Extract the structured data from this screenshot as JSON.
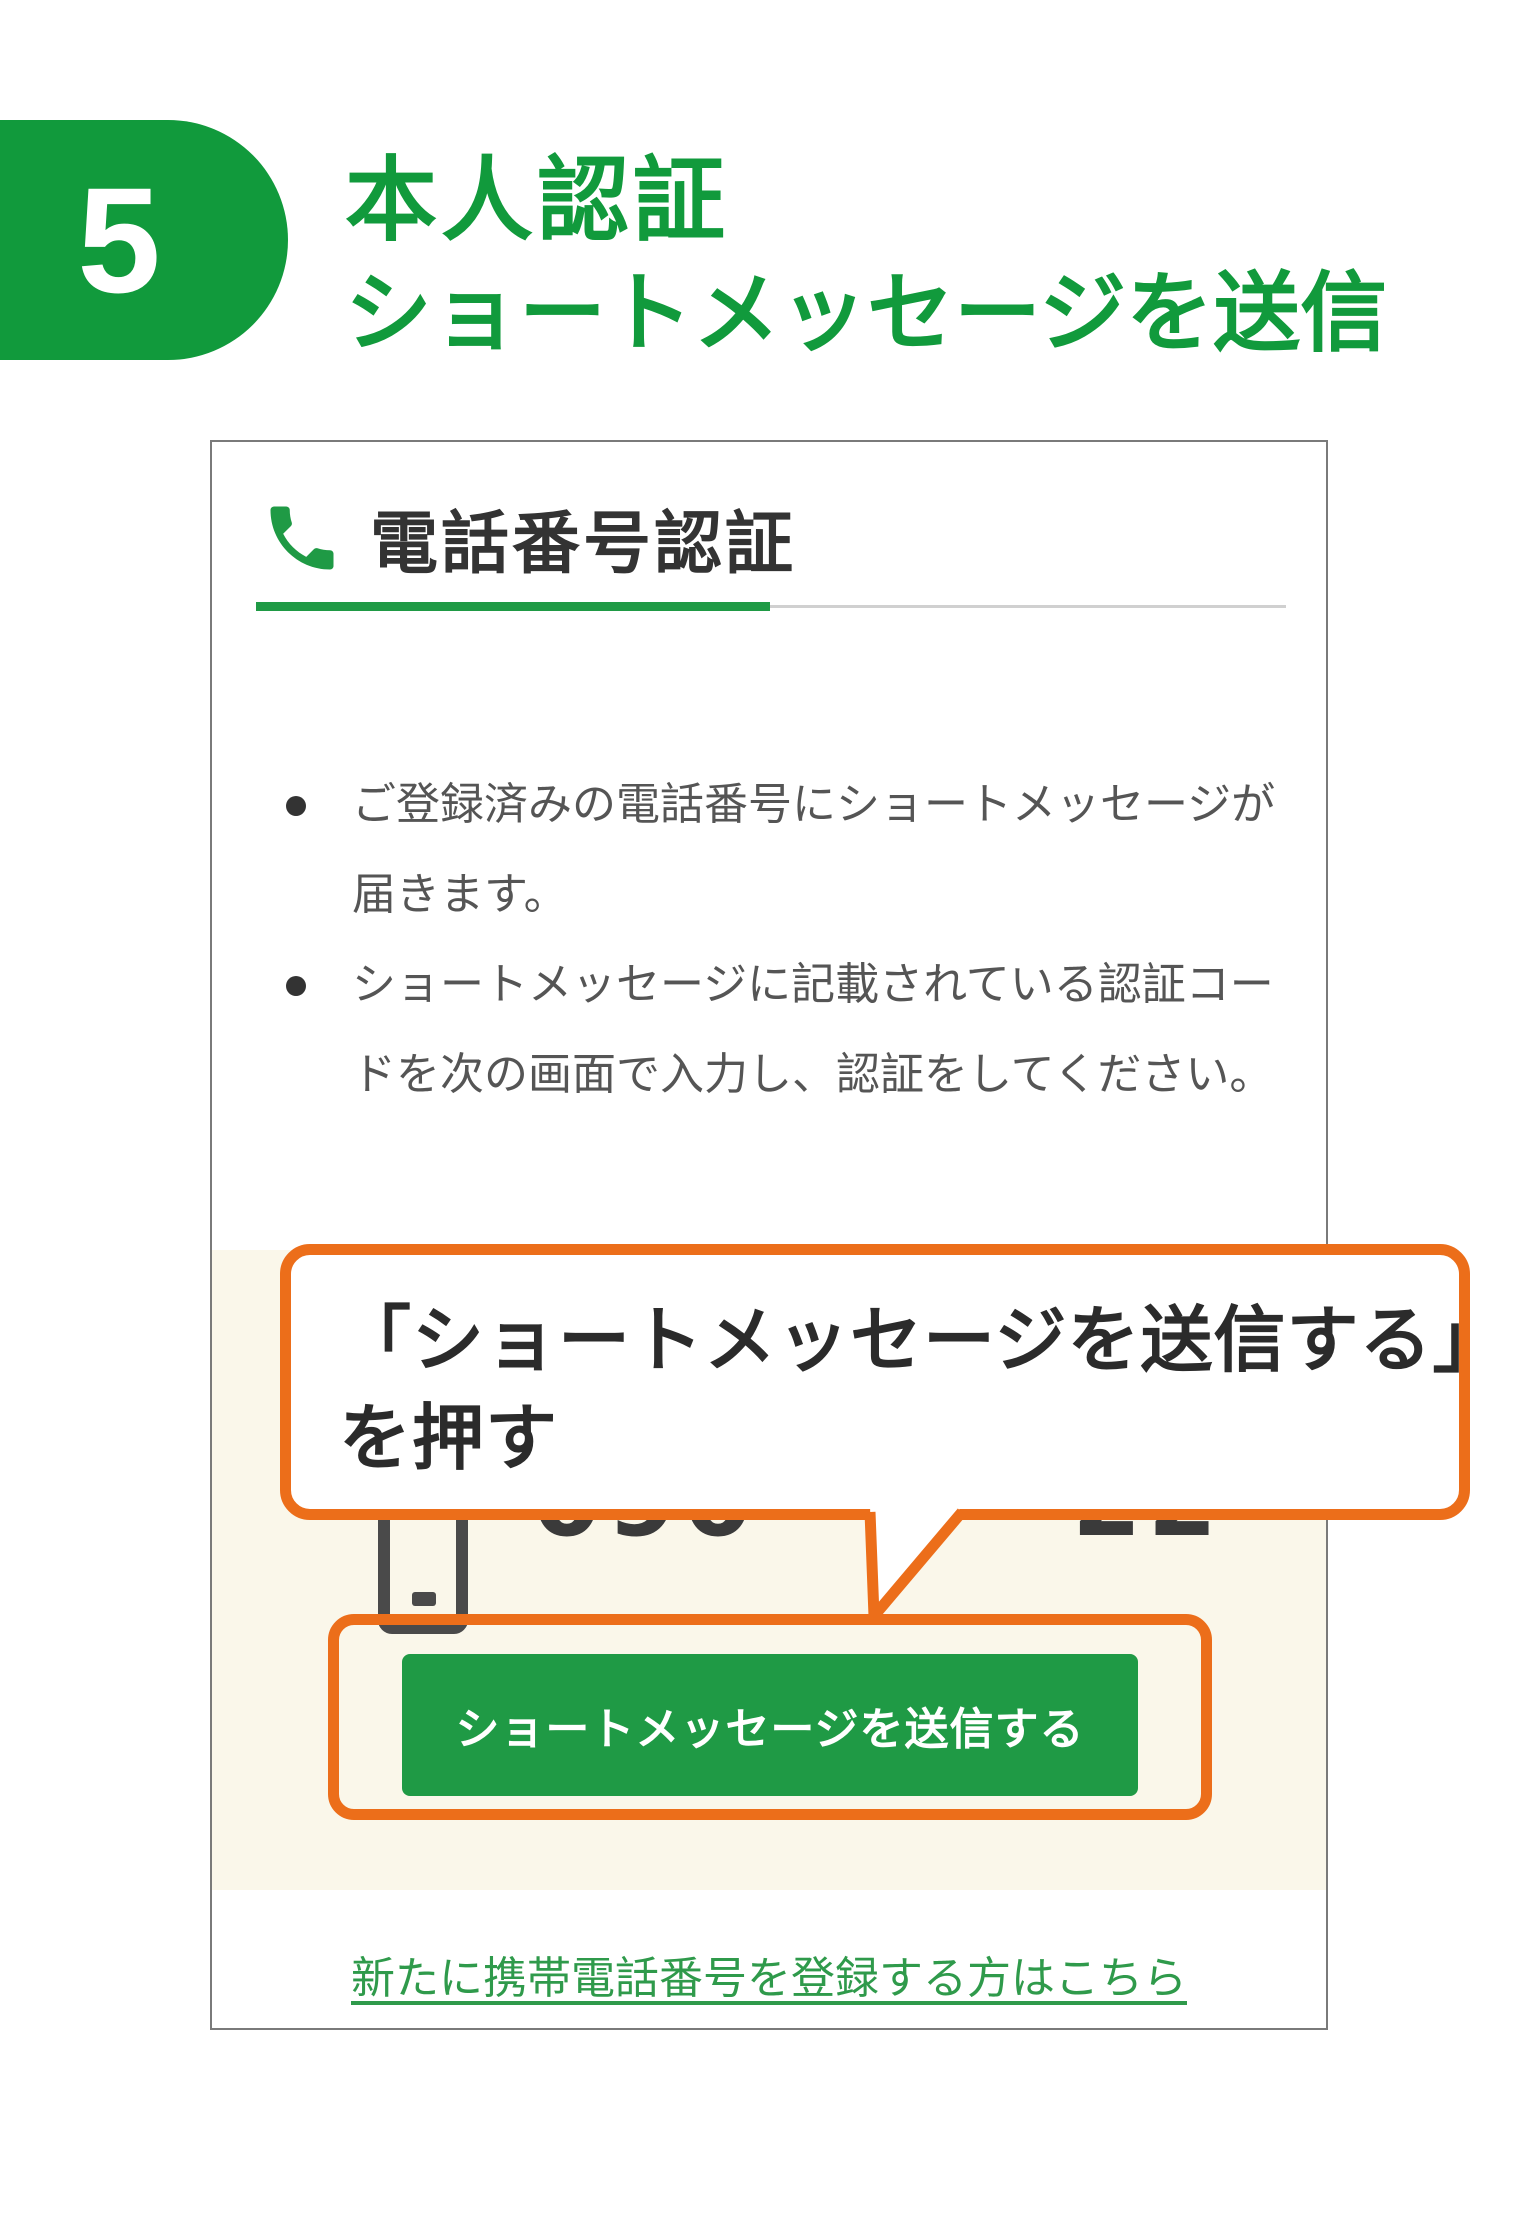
{
  "step": {
    "number": "5",
    "title_line1": "本人認証",
    "title_line2": "ショートメッセージを送信"
  },
  "panel": {
    "title": "電話番号認証",
    "bullets": [
      "ご登録済みの電話番号にショートメッセージが届きます。",
      "ショートメッセージに記載されている認証コードを次の画面で入力し、認証をしてください。"
    ],
    "phone_number_start": "090",
    "phone_number_end": "22",
    "send_button_label": "ショートメッセージを送信する",
    "register_link": "新たに携帯電話番号を登録する方はこちら"
  },
  "callout": {
    "line1": "「ショートメッセージを送信する」",
    "line2": "を押す"
  },
  "colors": {
    "brand_green": "#119a3c",
    "button_green": "#1f9a45",
    "highlight_orange": "#ec6e1a",
    "beige": "#faf7ea"
  },
  "icons": {
    "header": "phone-icon",
    "device": "mobile-phone-icon"
  }
}
